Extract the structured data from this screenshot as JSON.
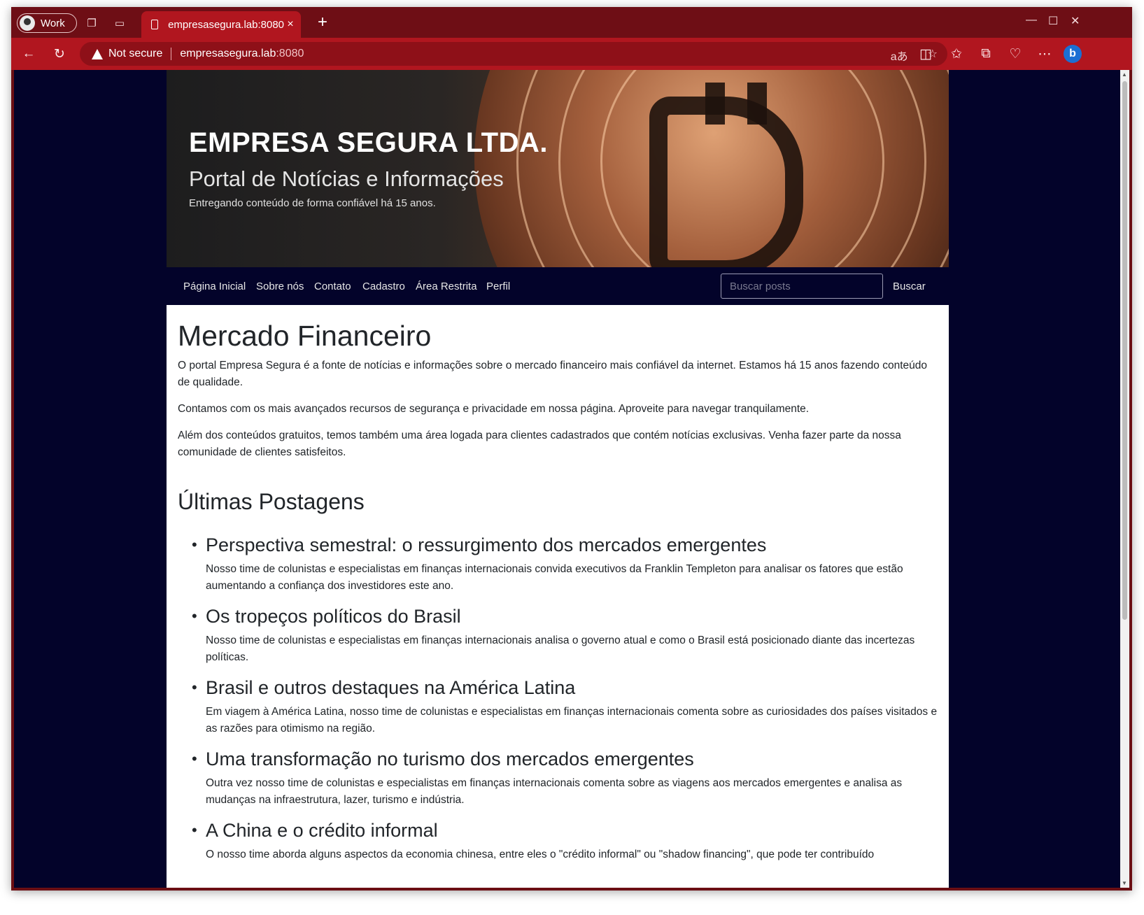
{
  "browser": {
    "profile_label": "Work",
    "tab_title": "empresasegura.lab:8080",
    "tab_close": "×",
    "new_tab": "+",
    "security_label": "Not secure",
    "url_host": "empresasegura.lab",
    "url_port": ":8080",
    "translate_icon": "aあ",
    "window_controls": {
      "minimize": "—",
      "maximize": "☐",
      "close": "✕"
    },
    "colors": {
      "frame": "#6e0e15",
      "toolbar": "#b1161f",
      "omnibox": "#8e1018"
    }
  },
  "site": {
    "hero": {
      "title": "EMPRESA SEGURA LTDA.",
      "subtitle": "Portal de Notícias e Informações",
      "tagline": "Entregando conteúdo de forma confiável há 15 anos."
    },
    "nav": {
      "items": [
        "Página Inicial",
        "Sobre nós",
        "Contato",
        "Cadastro",
        "Área Restrita",
        "Perfil"
      ],
      "search_placeholder": "Buscar posts",
      "search_button": "Buscar"
    },
    "main": {
      "heading": "Mercado Financeiro",
      "paragraphs": [
        "O portal Empresa Segura é a fonte de notícias e informações sobre o mercado financeiro mais confiável da internet. Estamos há 15 anos fazendo conteúdo de qualidade.",
        "Contamos com os mais avançados recursos de segurança e privacidade em nossa página. Aproveite para navegar tranquilamente.",
        "Além dos conteúdos gratuitos, temos também uma área logada para clientes cadastrados que contém notícias exclusivas. Venha fazer parte da nossa comunidade de clientes satisfeitos."
      ],
      "posts_heading": "Últimas Postagens",
      "posts": [
        {
          "title": "Perspectiva semestral: o ressurgimento dos mercados emergentes",
          "body": "Nosso time de colunistas e especialistas em finanças internacionais convida executivos da Franklin Templeton para analisar os fatores que estão aumentando a confiança dos investidores este ano."
        },
        {
          "title": "Os tropeços políticos do Brasil",
          "body": "Nosso time de colunistas e especialistas em finanças internacionais analisa o governo atual e como o Brasil está posicionado diante das incertezas políticas."
        },
        {
          "title": "Brasil e outros destaques na América Latina",
          "body": "Em viagem à América Latina, nosso time de colunistas e especialistas em finanças internacionais comenta sobre as curiosidades dos países visitados e as razões para otimismo na região."
        },
        {
          "title": "Uma transformação no turismo dos mercados emergentes",
          "body": "Outra vez nosso time de colunistas e especialistas em finanças internacionais comenta sobre as viagens aos mercados emergentes e analisa as mudanças na infraestrutura, lazer, turismo e indústria."
        },
        {
          "title": "A China e o crédito informal",
          "body": "O nosso time aborda alguns aspectos da economia chinesa, entre eles o \"crédito informal\" ou \"shadow financing\", que pode ter contribuído"
        }
      ]
    }
  }
}
